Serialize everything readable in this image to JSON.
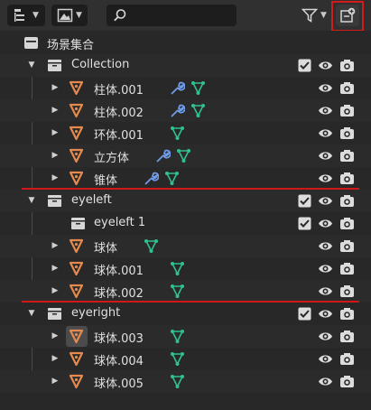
{
  "toolbar": {
    "search_placeholder": "",
    "display_mode_icon": "outliner-display-icon",
    "filter_icon": "funnel-icon",
    "new_collection_icon": "new-collection-icon",
    "highlight_color": "#d21c1c"
  },
  "scene": {
    "label": "场景集合"
  },
  "collections": [
    {
      "label": "Collection",
      "items": [
        {
          "label": "柱体.001",
          "modifier": true
        },
        {
          "label": "柱体.002",
          "modifier": true
        },
        {
          "label": "环体.001",
          "modifier": false
        },
        {
          "label": "立方体",
          "modifier": true
        },
        {
          "label": "锥体",
          "modifier": true
        }
      ]
    },
    {
      "label": "eyeleft",
      "sub": {
        "label": "eyeleft 1"
      },
      "items": [
        {
          "label": "球体",
          "modifier": false
        },
        {
          "label": "球体.001",
          "modifier": false
        },
        {
          "label": "球体.002",
          "modifier": false
        }
      ]
    },
    {
      "label": "eyeright",
      "items": [
        {
          "label": "球体.003",
          "modifier": false
        },
        {
          "label": "球体.004",
          "modifier": false
        },
        {
          "label": "球体.005",
          "modifier": false
        }
      ]
    }
  ],
  "colors": {
    "object_orange": "#e7894b",
    "mesh_green": "#2fc28f",
    "wrench_blue": "#6f9be8",
    "annotation_red": "#d01818"
  }
}
